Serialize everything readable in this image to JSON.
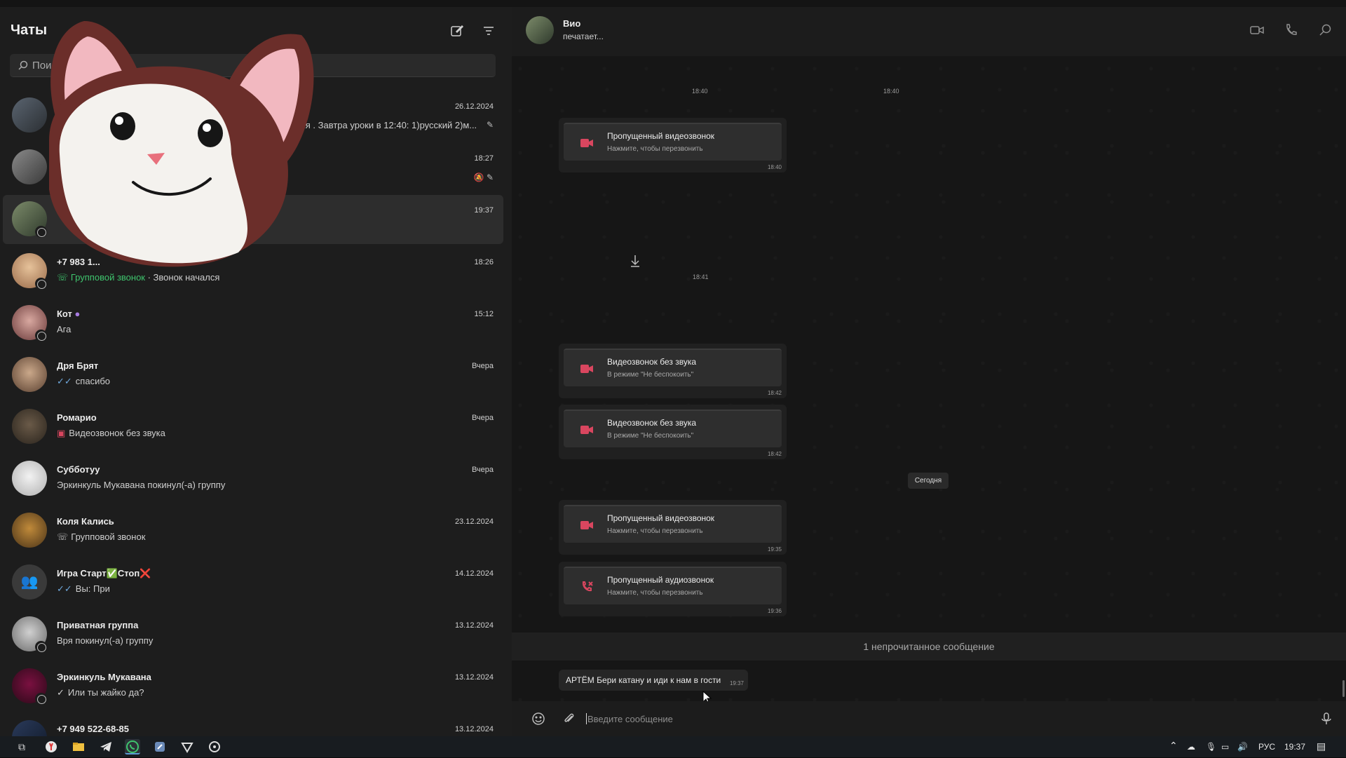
{
  "sidebar": {
    "title": "Чаты",
    "search_placeholder": "Поиск",
    "chats": [
      {
        "name": "",
        "preview": "дня .  Завтра уроки в 12:40: 1)русский 2)м...",
        "time": "26.12.2024",
        "icons": "pin"
      },
      {
        "name": "",
        "preview": "",
        "time": "18:27",
        "icons": "muted,pin"
      },
      {
        "name": "",
        "preview": "",
        "time": "19:37",
        "icons": ""
      },
      {
        "name": "+7 983 1...",
        "preview_prefix": "Групповой звонок",
        "preview": " · Звонок начался",
        "time": "18:26"
      },
      {
        "name": "Кот",
        "preview": "Ага",
        "time": "15:12"
      },
      {
        "name": "Дря Брят",
        "preview": "спасибо",
        "time": "Вчера"
      },
      {
        "name": "Ромарио",
        "preview": "Видеозвонок без звука",
        "time": "Вчера"
      },
      {
        "name": "Субботуу",
        "preview": "Эркинкуль Мукавана покинул(-а) группу",
        "time": "Вчера"
      },
      {
        "name": "Коля Кались",
        "preview": "Групповой звонок",
        "time": "23.12.2024"
      },
      {
        "name": "Игра Старт✅Стоп❌",
        "preview": "Вы: При",
        "time": "14.12.2024"
      },
      {
        "name": "Приватная группа",
        "preview": "Вря покинул(-а) группу",
        "time": "13.12.2024"
      },
      {
        "name": "Эркинкуль Мукавана",
        "preview": "Или ты жайко да?",
        "time": "13.12.2024"
      },
      {
        "name": "+7 949 522-68-85",
        "preview": "",
        "time": "13.12.2024"
      }
    ]
  },
  "conversation": {
    "contact_name": "Вио",
    "contact_status": "печатает...",
    "timestamps_top": [
      "18:40",
      "18:40"
    ],
    "ts_1841": "18:41",
    "calls": [
      {
        "title": "Пропущенный видеозвонок",
        "subtitle": "Нажмите, чтобы перезвонить",
        "time": "18:40",
        "kind": "video-missed"
      },
      {
        "title": "Видеозвонок без звука",
        "subtitle": "В режиме \"Не беспокоить\"",
        "time": "18:42",
        "kind": "video-silent"
      },
      {
        "title": "Видеозвонок без звука",
        "subtitle": "В режиме \"Не беспокоить\"",
        "time": "18:42",
        "kind": "video-silent"
      },
      {
        "title": "Пропущенный видеозвонок",
        "subtitle": "Нажмите, чтобы перезвонить",
        "time": "19:35",
        "kind": "video-missed"
      },
      {
        "title": "Пропущенный аудиозвонок",
        "subtitle": "Нажмите, чтобы перезвонить",
        "time": "19:36",
        "kind": "audio-missed"
      }
    ],
    "date_divider": "Сегодня",
    "unread_banner": "1 непрочитанное сообщение",
    "incoming_message": {
      "text": "АРТЁМ Бери катану и иди к нам в гости",
      "time": "19:37"
    },
    "composer_placeholder": "Введите сообщение"
  },
  "taskbar": {
    "language": "РУС",
    "clock": "19:37"
  },
  "colors": {
    "accent_green": "#3ec46d",
    "missed_call_red": "#d9465f",
    "tick_blue": "#6fa8dc"
  }
}
